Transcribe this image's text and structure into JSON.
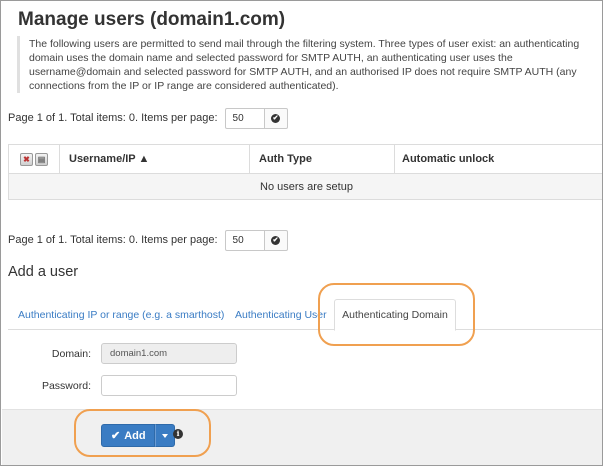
{
  "page": {
    "title": "Manage users (domain1.com)",
    "description": "The following users are permitted to send mail through the filtering system. Three types of user exist: an authenticating domain uses the domain name and selected password for SMTP AUTH, an authenticating user uses the username@domain and selected password for SMTP AUTH, and an authorised IP does not require SMTP AUTH (any connections from the IP or IP range are considered authenticated)."
  },
  "pager_top": {
    "text": "Page 1 of 1. Total items: 0. Items per page:",
    "per_page": "50",
    "apply_icon": "check-circle-icon"
  },
  "table": {
    "header_icons": [
      "delete-selected-icon",
      "select-all-icon"
    ],
    "columns": [
      "Username/IP ▲",
      "Auth Type",
      "Automatic unlock"
    ],
    "empty_message": "No users are setup"
  },
  "pager_bottom": {
    "text": "Page 1 of 1. Total items: 0. Items per page:",
    "per_page": "50",
    "apply_icon": "check-circle-icon"
  },
  "add_user": {
    "heading": "Add a user",
    "tabs": [
      {
        "label": "Authenticating IP or range (e.g. a smarthost)",
        "active": false
      },
      {
        "label": "Authenticating User",
        "active": false
      },
      {
        "label": "Authenticating Domain",
        "active": true
      }
    ],
    "domain_label": "Domain:",
    "domain_value": "domain1.com",
    "password_label": "Password:",
    "password_value": "",
    "add_button": "Add",
    "add_icon": "check-icon",
    "dropdown_icon": "caret-down-icon",
    "info_icon": "info-icon"
  },
  "colors": {
    "accent": "#3a7cc3",
    "highlight": "#f0a050",
    "link": "#3a7cc4"
  }
}
